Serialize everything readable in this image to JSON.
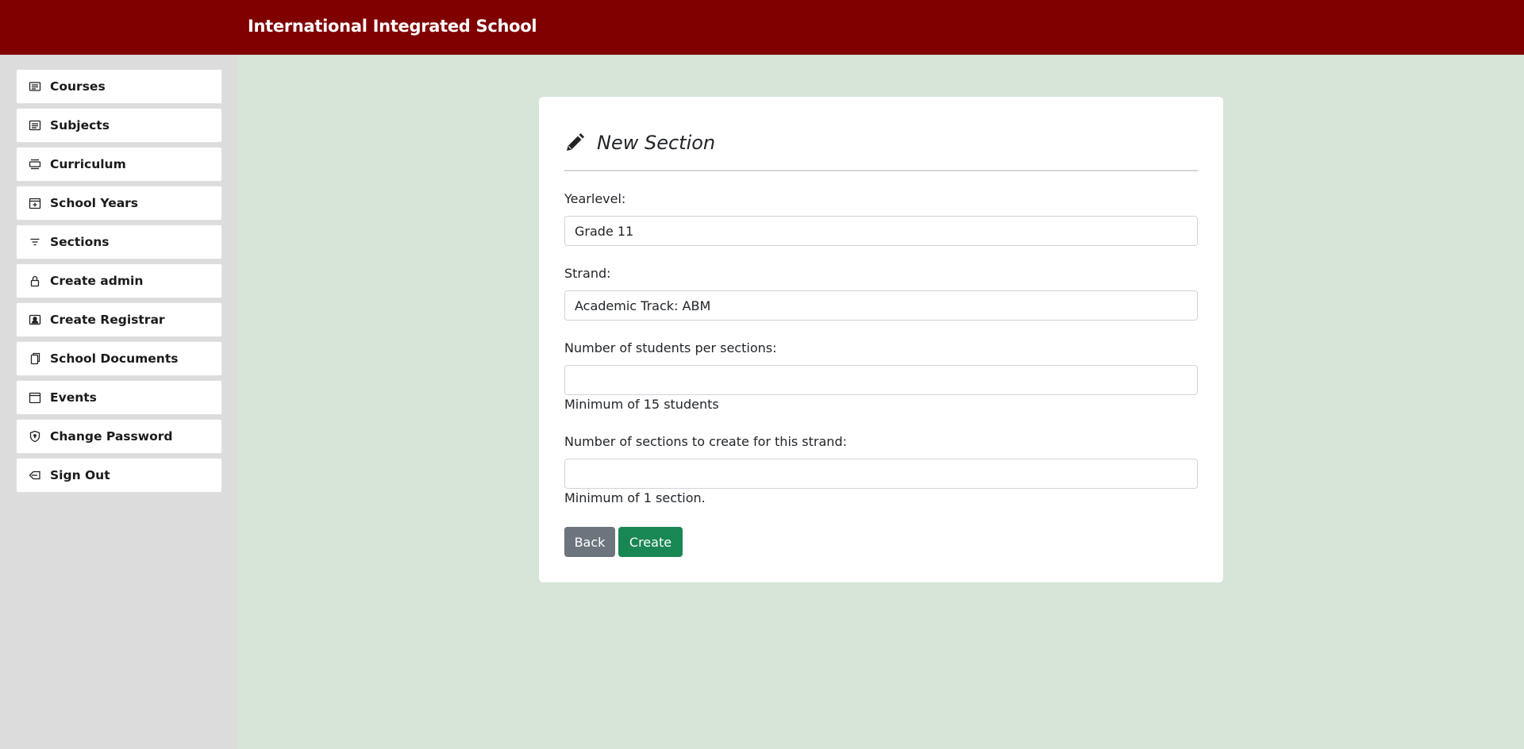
{
  "header": {
    "brand": "International Integrated School",
    "bg_color": "#800000"
  },
  "sidebar": {
    "items": [
      {
        "label": "Courses",
        "icon": "courses-icon"
      },
      {
        "label": "Subjects",
        "icon": "subjects-icon"
      },
      {
        "label": "Curriculum",
        "icon": "curriculum-icon"
      },
      {
        "label": "School Years",
        "icon": "calendar-plus-icon"
      },
      {
        "label": "Sections",
        "icon": "filter-icon"
      },
      {
        "label": "Create admin",
        "icon": "lock-icon"
      },
      {
        "label": "Create Registrar",
        "icon": "person-badge-icon"
      },
      {
        "label": "School Documents",
        "icon": "documents-icon"
      },
      {
        "label": "Events",
        "icon": "calendar-icon"
      },
      {
        "label": "Change Password",
        "icon": "shield-icon"
      },
      {
        "label": "Sign Out",
        "icon": "sign-out-icon"
      }
    ]
  },
  "form": {
    "title": "New Section",
    "yearlevel_label": "Yearlevel:",
    "yearlevel_value": "Grade 11",
    "strand_label": "Strand:",
    "strand_value": "Academic Track: ABM",
    "students_label": "Number of students per sections:",
    "students_value": "",
    "students_hint": "Minimum of 15 students",
    "sections_label": "Number of sections to create for this strand:",
    "sections_value": "",
    "sections_hint": "Minimum of 1 section.",
    "back_label": "Back",
    "create_label": "Create"
  },
  "colors": {
    "page_bg": "#d5e4d7",
    "sidebar_bg": "#dcdcdc",
    "back_btn": "#6c757d",
    "create_btn": "#198754"
  }
}
